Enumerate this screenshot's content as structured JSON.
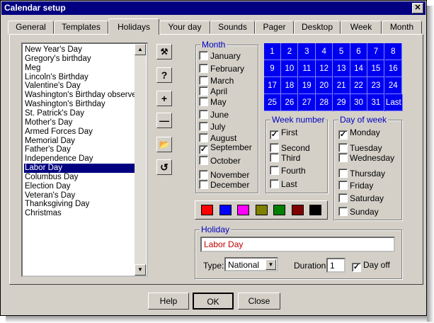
{
  "window": {
    "title": "Calendar setup",
    "close_label": "✕"
  },
  "tabs": [
    "General",
    "Templates",
    "Holidays",
    "Your day",
    "Sounds",
    "Pager",
    "Desktop",
    "Week",
    "Month"
  ],
  "active_tab": "Holidays",
  "holidays": [
    "New Year's Day",
    "Gregory's birthday",
    "Meg",
    "Lincoln's Birthday",
    "Valentine's Day",
    "Washington's Birthday observed",
    "Washington's Birthday",
    "St. Patrick's Day",
    "Mother's Day",
    "Armed Forces Day",
    "Memorial Day",
    "Father's Day",
    "Independence Day",
    "Labor Day",
    "Columbus Day",
    "Election Day",
    "Veteran's Day",
    "Thanksgiving Day",
    "Christmas"
  ],
  "selected_holiday": "Labor Day",
  "toolbar": {
    "icons": [
      "wizard-icon",
      "help-icon",
      "add-icon",
      "remove-icon",
      "open-folder-icon",
      "reset-icon"
    ],
    "symbols": [
      "⚒",
      "?",
      "+",
      "—",
      "📂",
      "↺"
    ]
  },
  "month_group": {
    "legend": "Month",
    "months": [
      "January",
      "February",
      "March",
      "April",
      "May",
      "June",
      "July",
      "August",
      "September",
      "October",
      "November",
      "December"
    ],
    "checked": [
      "September"
    ]
  },
  "calendar_days": [
    "1",
    "2",
    "3",
    "4",
    "5",
    "6",
    "7",
    "8",
    "9",
    "10",
    "11",
    "12",
    "13",
    "14",
    "15",
    "16",
    "17",
    "18",
    "19",
    "20",
    "21",
    "22",
    "23",
    "24",
    "25",
    "26",
    "27",
    "28",
    "29",
    "30",
    "31",
    "Last"
  ],
  "week_number": {
    "legend": "Week number",
    "options": [
      "First",
      "Second",
      "Third",
      "Fourth",
      "Last"
    ],
    "checked": [
      "First"
    ]
  },
  "day_of_week": {
    "legend": "Day of week",
    "options": [
      "Monday",
      "Tuesday",
      "Wednesday",
      "Thursday",
      "Friday",
      "Saturday",
      "Sunday"
    ],
    "checked": [
      "Monday"
    ]
  },
  "swatches": [
    "#ff0000",
    "#0000ff",
    "#ff00ff",
    "#808000",
    "#008000",
    "#800000",
    "#000000"
  ],
  "holiday_group": {
    "legend": "Holiday",
    "name_value": "Labor Day",
    "name_color": "#c00000",
    "type_label": "Type:",
    "type_value": "National",
    "duration_label": "Duration:",
    "duration_value": "1",
    "day_off_label": "Day off",
    "day_off_checked": true
  },
  "buttons": {
    "help": "Help",
    "ok": "OK",
    "close": "Close"
  }
}
